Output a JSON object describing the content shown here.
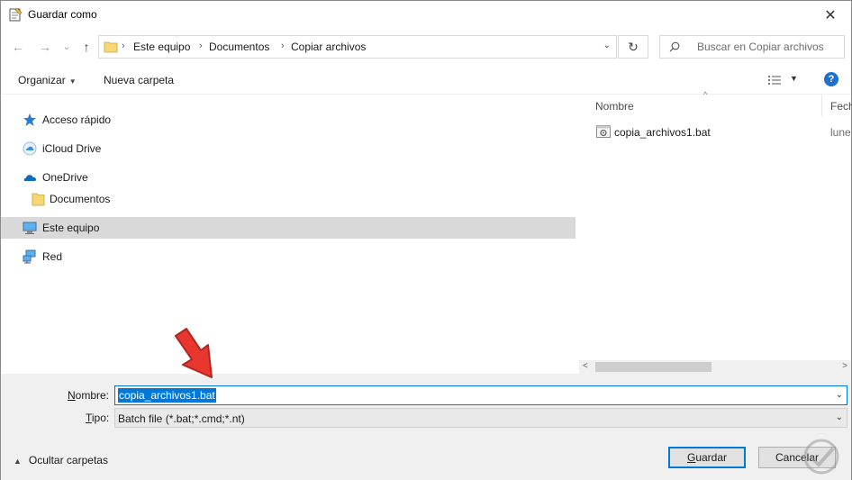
{
  "window": {
    "title": "Guardar como",
    "close_glyph": "✕"
  },
  "nav_buttons": {
    "back": "←",
    "forward": "→",
    "up": "↑",
    "recent": "⌄"
  },
  "address": {
    "breadcrumbs": [
      "Este equipo",
      "Documentos",
      "Copiar archivos"
    ],
    "separator": "›",
    "dropdown_glyph": "⌄"
  },
  "refresh_glyph": "↻",
  "search": {
    "placeholder": "Buscar en Copiar archivos"
  },
  "toolbar": {
    "organize": "Organizar",
    "organize_caret": "▼",
    "new_folder": "Nueva carpeta",
    "view_caret": "▼",
    "help": "?"
  },
  "nav_pane": {
    "items": [
      {
        "label": "Acceso rápido",
        "icon": "star-icon"
      },
      {
        "label": "iCloud Drive",
        "icon": "icloud-icon"
      },
      {
        "label": "OneDrive",
        "icon": "onedrive-icon"
      },
      {
        "label": "Documentos",
        "icon": "folder-icon"
      },
      {
        "label": "Este equipo",
        "icon": "computer-icon",
        "selected": true
      },
      {
        "label": "Red",
        "icon": "network-icon"
      }
    ]
  },
  "file_list": {
    "columns": {
      "name": "Nombre",
      "date": "Fech"
    },
    "sort_glyph": "^",
    "files": [
      {
        "name": "copia_archivos1.bat",
        "date": "lune",
        "icon": "bat-file-icon"
      }
    ]
  },
  "scrollbar": {
    "left": "<",
    "right": ">"
  },
  "save_form": {
    "name_label_u": "N",
    "name_label_rest": "ombre:",
    "name_value": "copia_archivos1.bat",
    "type_label_u": "T",
    "type_label_rest": "ipo:",
    "type_value": "Batch file (*.bat;*.cmd;*.nt)",
    "dropdown_glyph": "⌄"
  },
  "footer": {
    "hide_folders": "Ocultar carpetas",
    "hide_caret": "▲",
    "save_u": "G",
    "save_rest": "uardar",
    "cancel": "Cancelar"
  },
  "colors": {
    "accent": "#0078d7",
    "selection": "#d9d9d9",
    "bottom_bg": "#f0f0f0",
    "arrow": "#e8372f"
  }
}
